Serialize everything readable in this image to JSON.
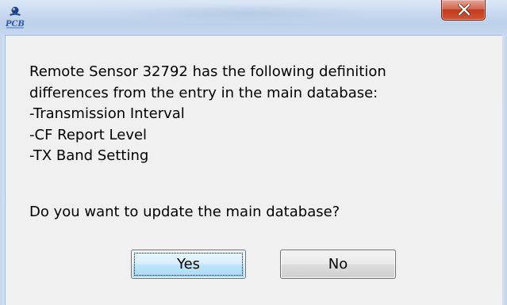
{
  "dialog": {
    "message_lines": [
      "Remote Sensor 32792 has the following definition",
      "differences from the entry in the main database:",
      "-Transmission Interval",
      "-CF Report Level",
      "-TX Band Setting"
    ],
    "question": "Do you want to update the main database?",
    "buttons": {
      "yes": "Yes",
      "no": "No"
    },
    "icons": {
      "app": "pcb-app-icon",
      "close": "close-icon"
    },
    "colors": {
      "close_button": "#c2391b",
      "client_background": "#f0f0f0",
      "default_button_border": "#3c7fb1"
    }
  }
}
